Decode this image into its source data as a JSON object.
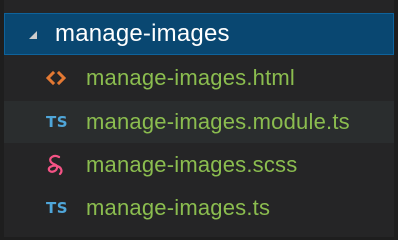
{
  "explorer": {
    "folder": {
      "label": "manage-images",
      "icon": "chevron-expanded-icon"
    },
    "files": [
      {
        "label": "manage-images.html",
        "icon": "html-file-icon",
        "icon_text": ""
      },
      {
        "label": "manage-images.module.ts",
        "icon": "typescript-file-icon",
        "icon_text": "TS"
      },
      {
        "label": "manage-images.scss",
        "icon": "sass-file-icon",
        "icon_text": ""
      },
      {
        "label": "manage-images.ts",
        "icon": "typescript-file-icon",
        "icon_text": "TS"
      }
    ]
  },
  "colors": {
    "background": "#252526",
    "selected_row": "#094771",
    "file_text": "#8bbd4f",
    "html_icon": "#e37933",
    "ts_icon": "#4fa6d9",
    "sass_icon": "#f55385"
  }
}
